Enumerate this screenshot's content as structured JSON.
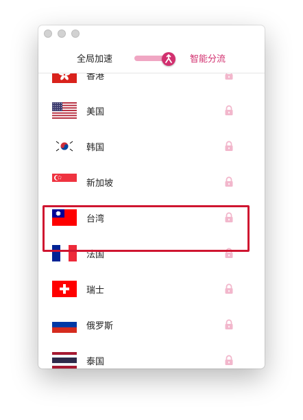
{
  "header": {
    "mode_global": "全局加速",
    "mode_smart": "智能分流",
    "toggle_state": "smart"
  },
  "countries": [
    {
      "id": "hongkong",
      "name": "香港",
      "flag": "hk-flag",
      "locked": true
    },
    {
      "id": "usa",
      "name": "美国",
      "flag": "us-flag",
      "locked": true
    },
    {
      "id": "korea",
      "name": "韩国",
      "flag": "kr-flag",
      "locked": true
    },
    {
      "id": "singapore",
      "name": "新加坡",
      "flag": "sg-flag",
      "locked": true
    },
    {
      "id": "taiwan",
      "name": "台湾",
      "flag": "tw-flag",
      "locked": true
    },
    {
      "id": "france",
      "name": "法国",
      "flag": "fr-flag",
      "locked": true
    },
    {
      "id": "switzerland",
      "name": "瑞士",
      "flag": "ch-flag",
      "locked": true
    },
    {
      "id": "russia",
      "name": "俄罗斯",
      "flag": "ru-flag",
      "locked": true
    },
    {
      "id": "partial",
      "name": "泰国",
      "flag": "partial-flag",
      "locked": true
    }
  ],
  "colors": {
    "accent": "#d2306f",
    "toggle_track": "#f0a6c3",
    "lock": "#f2b7cc",
    "highlight": "#cf1530"
  },
  "highlighted": "taiwan"
}
